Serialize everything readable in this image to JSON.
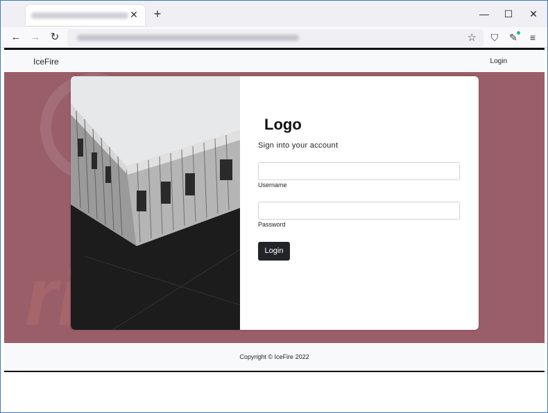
{
  "browser": {
    "tab_close": "✕",
    "new_tab": "+",
    "minimize": "—",
    "maximize": "☐",
    "close": "✕",
    "back": "←",
    "forward": "→",
    "reload": "↻",
    "bookmark": "☆",
    "shield": "⛉",
    "extension": "✎",
    "menu": "≡",
    "accent": "#21b88c"
  },
  "site": {
    "brand": "IceFire",
    "nav_login": "Login",
    "background": "#9a5e69"
  },
  "form": {
    "logo": "Logo",
    "subtitle": "Sign into your account",
    "username_label": "Username",
    "username_value": "",
    "password_label": "Password",
    "password_value": "",
    "submit": "Login"
  },
  "footer": {
    "copyright": "Copyright © IceFire 2022"
  }
}
